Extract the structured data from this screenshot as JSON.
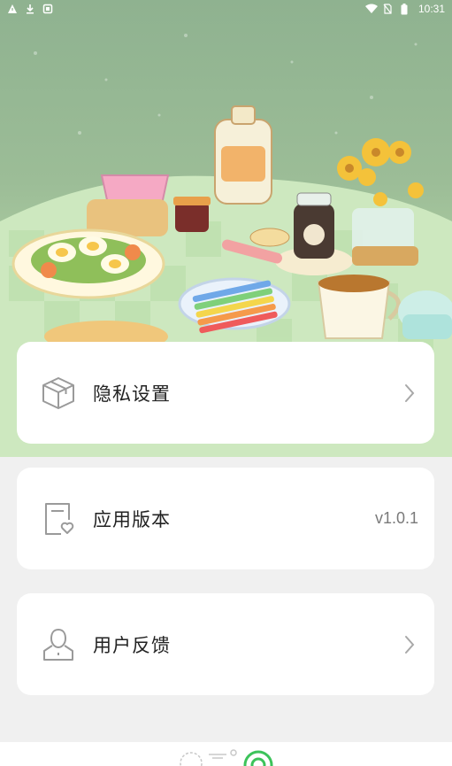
{
  "status_bar": {
    "time": "10:31",
    "left_icons": [
      "warning-icon",
      "download-icon",
      "app-notification-icon"
    ],
    "right_icons": [
      "wifi-icon",
      "no-sim-icon",
      "battery-icon"
    ]
  },
  "menu": {
    "privacy": {
      "label": "隐私设置",
      "icon": "box-icon",
      "trailing": "chevron-right-icon"
    },
    "version": {
      "label": "应用版本",
      "icon": "document-heart-icon",
      "value": "v1.0.1"
    },
    "feedback": {
      "label": "用户反馈",
      "icon": "user-icon",
      "trailing": "chevron-right-icon"
    }
  },
  "colors": {
    "hero_green": "#9cbd97",
    "card_bg": "#ffffff",
    "page_bg": "#f0f0f0",
    "nav_accent": "#3cc35a"
  }
}
